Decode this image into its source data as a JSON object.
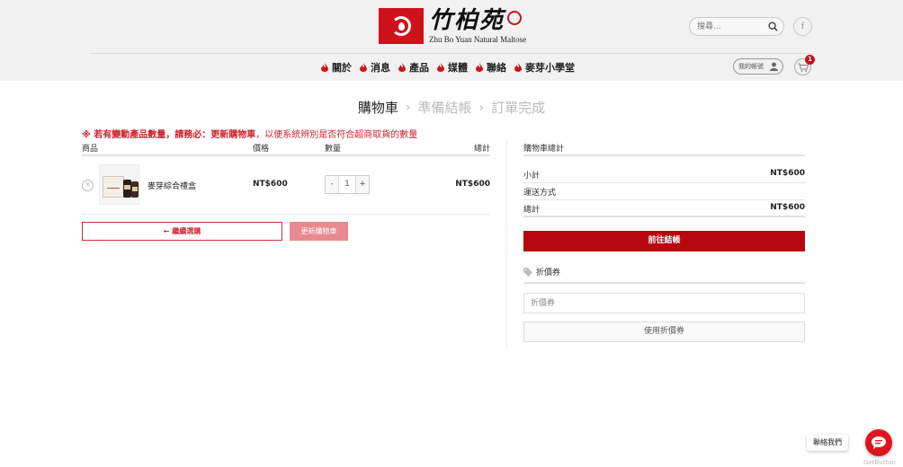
{
  "brand": {
    "name_cn": "竹柏苑",
    "name_en": "Zhu Bo Yuan Natural Maltose",
    "accent_color": "#d0111b"
  },
  "header": {
    "search_placeholder": "搜尋...",
    "facebook_label": "f",
    "account_label": "我的帳號",
    "cart_count": "1"
  },
  "nav": {
    "items": [
      {
        "label": "關於"
      },
      {
        "label": "消息"
      },
      {
        "label": "產品"
      },
      {
        "label": "媒體"
      },
      {
        "label": "聯絡"
      },
      {
        "label": "麥芽小學堂"
      }
    ]
  },
  "steps": {
    "cart": "購物車",
    "checkout": "準備結帳",
    "complete": "訂單完成",
    "separator": "›"
  },
  "notice": {
    "strong": "※ 若有變動產品數量，請務必：更新購物車",
    "rest": "，以便系統辨別是否符合超商取貨的數量"
  },
  "cart": {
    "col_product": "商品",
    "col_price": "價格",
    "col_qty": "數量",
    "col_total": "總計",
    "items": [
      {
        "remove": "×",
        "name": "麥芽綜合禮盒",
        "price": "NT$600",
        "qty": "1",
        "subtotal": "NT$600"
      }
    ],
    "qty_minus": "-",
    "qty_plus": "+",
    "continue_label": "← 繼續選購",
    "update_label": "更新購物車"
  },
  "totals": {
    "heading": "購物車總計",
    "subtotal_label": "小計",
    "subtotal_value": "NT$600",
    "shipping_label": "運送方式",
    "total_label": "總計",
    "total_value": "NT$600",
    "checkout_label": "前往結帳",
    "coupon_heading": "折價券",
    "coupon_placeholder": "折價券",
    "apply_label": "使用折價券"
  },
  "chat": {
    "label": "聯絡我們",
    "powered_by": "GetButton"
  }
}
